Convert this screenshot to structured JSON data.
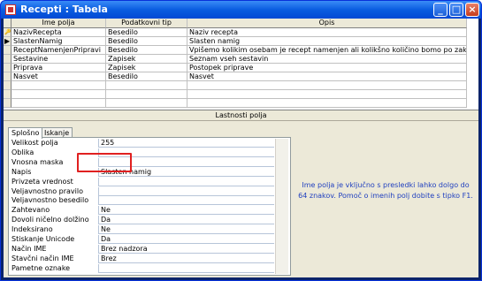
{
  "window": {
    "title": "Recepti : Tabela"
  },
  "grid": {
    "columns": [
      "Ime polja",
      "Podatkovni tip",
      "Opis"
    ],
    "rows": [
      {
        "name": "NazivRecepta",
        "type": "Besedilo",
        "desc": "Naziv recepta"
      },
      {
        "name": "SlastenNamig",
        "type": "Besedilo",
        "desc": "Slasten namig"
      },
      {
        "name": "ReceptNamenjenPripravi",
        "type": "Besedilo",
        "desc": "Vpišemo kolikim osebam je recept namenjen ali kolikšno količino bomo po zaključku pridobili"
      },
      {
        "name": "Sestavine",
        "type": "Zapisek",
        "desc": "Seznam vseh sestavin"
      },
      {
        "name": "Priprava",
        "type": "Zapisek",
        "desc": "Postopek priprave"
      },
      {
        "name": "Nasvet",
        "type": "Besedilo",
        "desc": "Nasvet"
      }
    ]
  },
  "properties": {
    "header": "Lastnosti polja",
    "tabs": [
      "Splošno",
      "Iskanje"
    ],
    "items": [
      {
        "label": "Velikost polja",
        "value": "255"
      },
      {
        "label": "Oblika",
        "value": ""
      },
      {
        "label": "Vnosna maska",
        "value": ""
      },
      {
        "label": "Napis",
        "value": "Slasten namig"
      },
      {
        "label": "Privzeta vrednost",
        "value": ""
      },
      {
        "label": "Veljavnostno pravilo",
        "value": ""
      },
      {
        "label": "Veljavnostno besedilo",
        "value": ""
      },
      {
        "label": "Zahtevano",
        "value": "Ne"
      },
      {
        "label": "Dovoli ničelno dolžino",
        "value": "Da"
      },
      {
        "label": "Indeksirano",
        "value": "Ne"
      },
      {
        "label": "Stiskanje Unicode",
        "value": "Da"
      },
      {
        "label": "Način IME",
        "value": "Brez nadzora"
      },
      {
        "label": "Stavčni način IME",
        "value": "Brez"
      },
      {
        "label": "Pametne oznake",
        "value": ""
      }
    ],
    "help_text": "Ime polja je vključno s presledki lahko dolgo do 64 znakov. Pomoč o imenih polj dobite s tipko F1."
  }
}
